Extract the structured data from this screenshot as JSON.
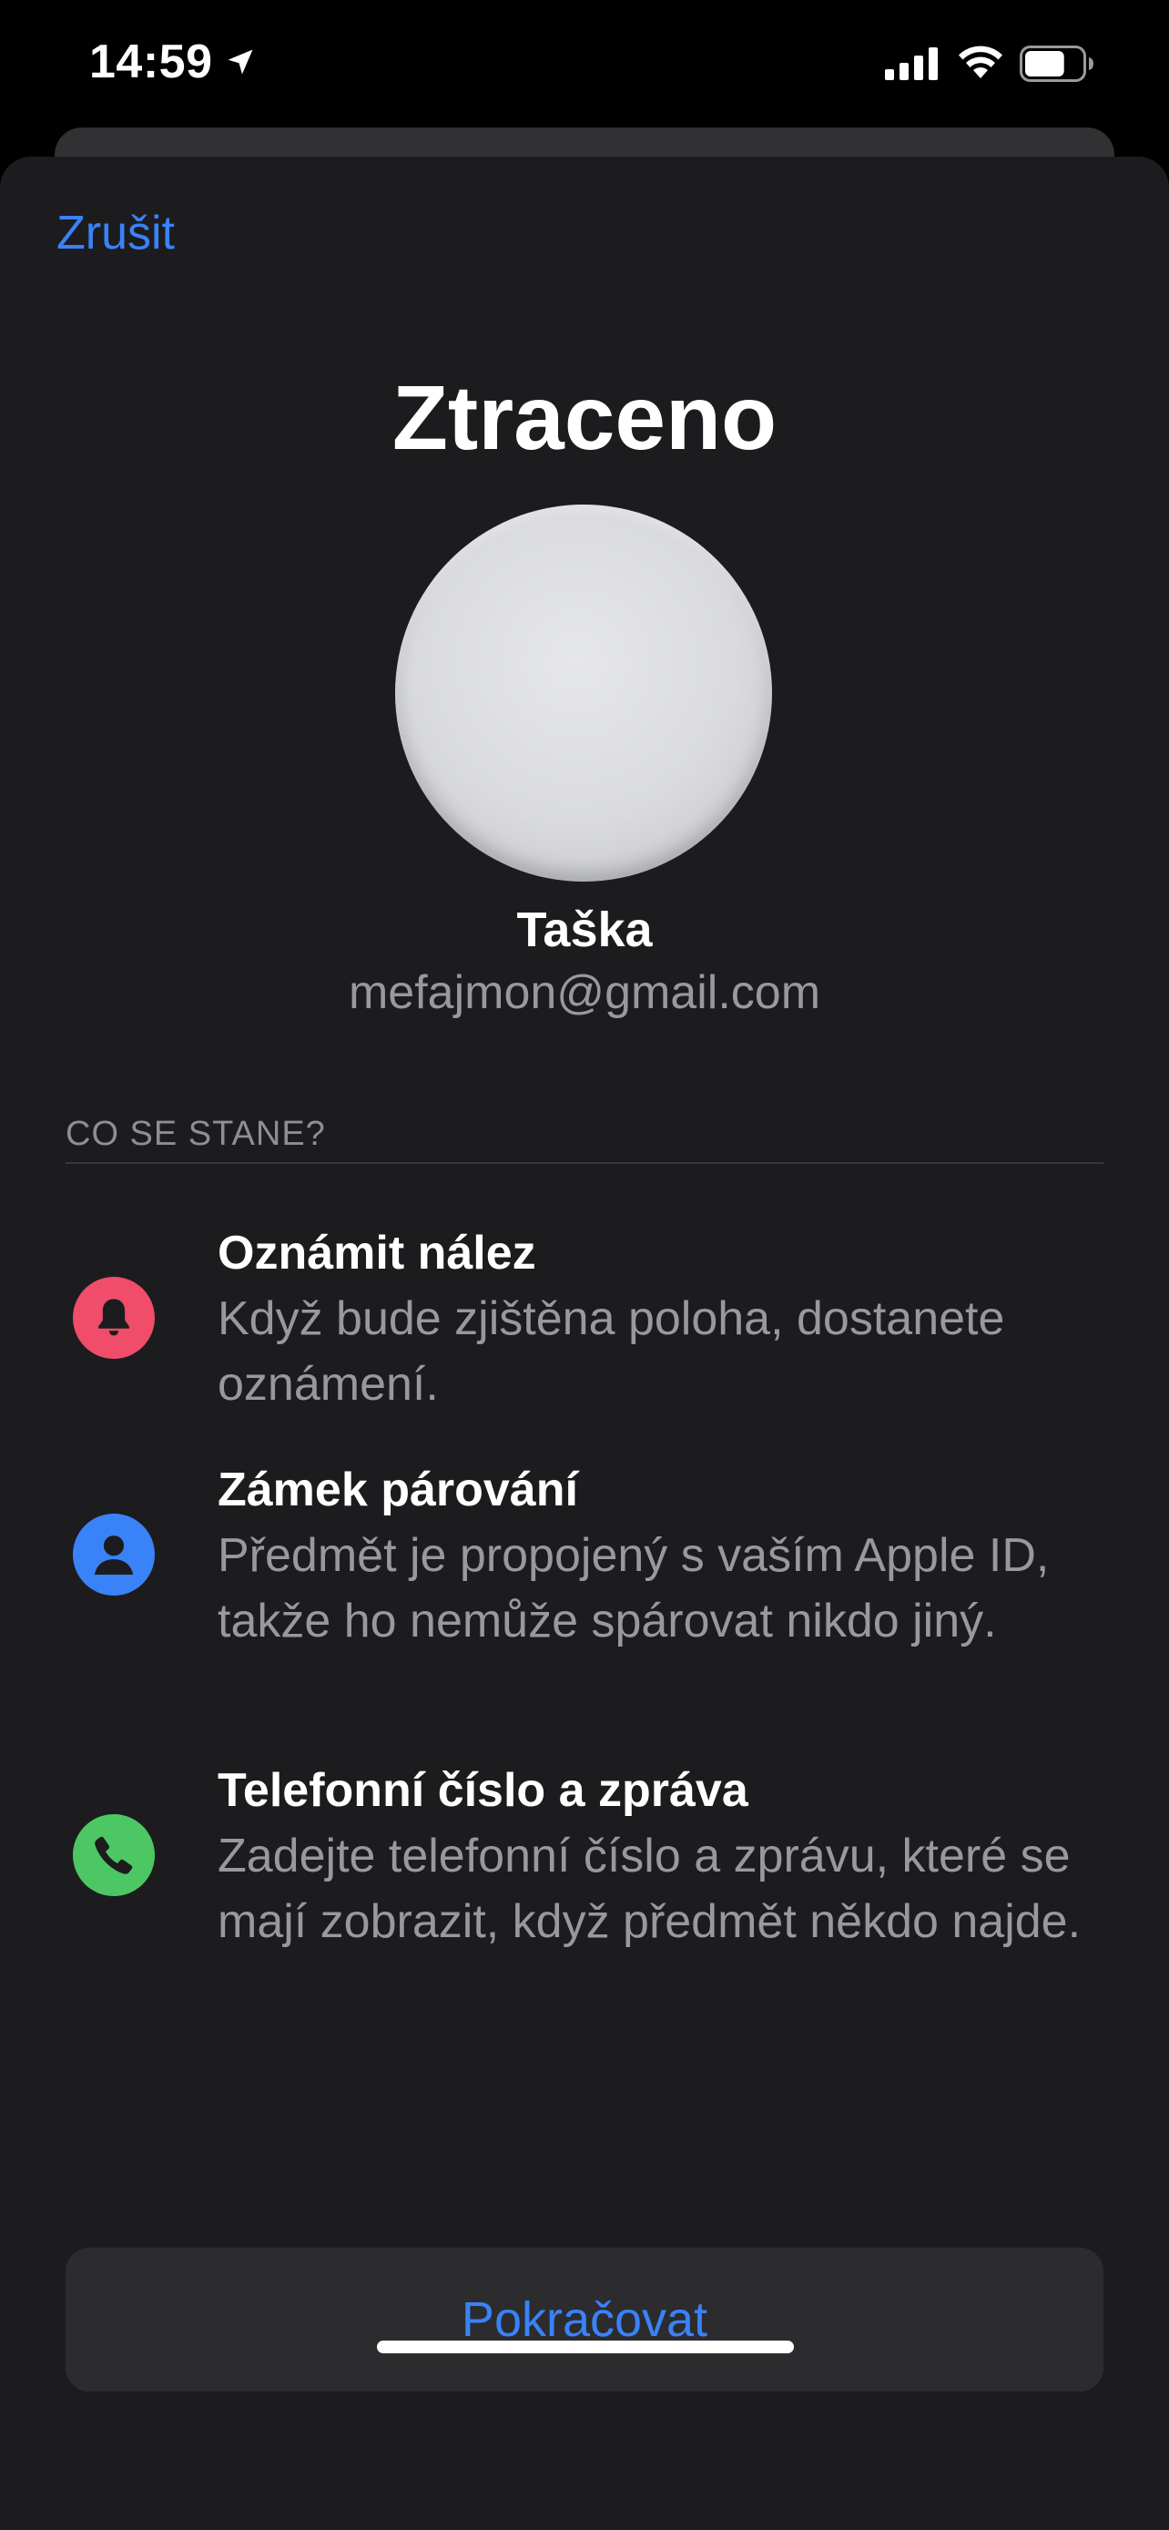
{
  "status_bar": {
    "time": "14:59",
    "location_icon": "location-arrow-icon",
    "signal_icon": "cellular-signal-icon",
    "wifi_icon": "wifi-icon",
    "battery_icon": "battery-icon",
    "battery_level": 0.7
  },
  "sheet": {
    "cancel_label": "Zrušit",
    "title": "Ztraceno",
    "item": {
      "name": "Taška",
      "email": "mefajmon@gmail.com"
    },
    "section_header": "CO SE STANE?",
    "features": [
      {
        "icon": "bell-icon",
        "color": "#ef4d6a",
        "title": "Oznámit nález",
        "text": "Když bude zjištěna poloha, dostanete oznámení."
      },
      {
        "icon": "person-icon",
        "color": "#3a82f7",
        "title": "Zámek párování",
        "text": "Předmět je propojený s vaším Apple ID, takže ho nemůže spárovat nikdo jiný."
      },
      {
        "icon": "phone-icon",
        "color": "#4cc764",
        "title": "Telefonní číslo a zpráva",
        "text": "Zadejte telefonní číslo a zprávu, které se mají zobrazit, když předmět někdo najde."
      }
    ],
    "continue_label": "Pokračovat"
  },
  "colors": {
    "accent": "#3a82f7",
    "sheet_background": "#1c1c1e",
    "button_background": "#2c2c2e",
    "secondary_text": "#98989d"
  }
}
